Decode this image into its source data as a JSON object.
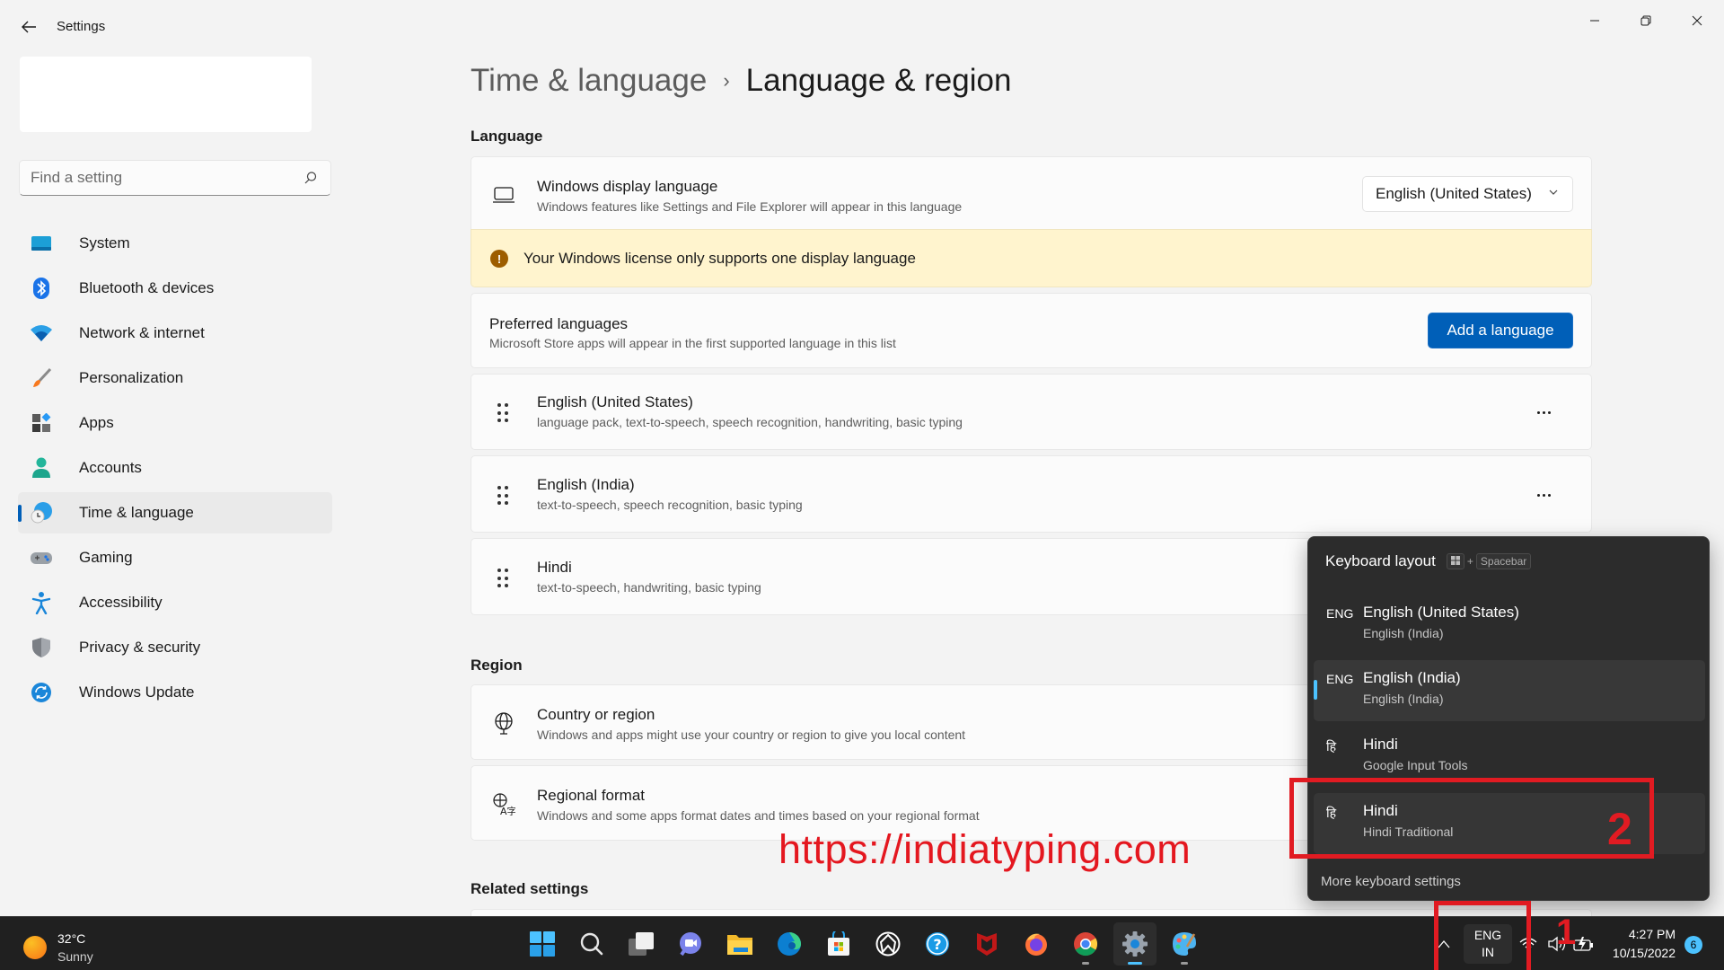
{
  "window": {
    "title": "Settings",
    "controls": {
      "minimize": "minimize",
      "restore": "restore",
      "close": "close"
    }
  },
  "search": {
    "placeholder": "Find a setting",
    "value": ""
  },
  "sidebar": {
    "items": [
      {
        "label": "System",
        "icon": "system-icon",
        "active": false
      },
      {
        "label": "Bluetooth & devices",
        "icon": "bluetooth-icon",
        "active": false
      },
      {
        "label": "Network & internet",
        "icon": "wifi-icon",
        "active": false
      },
      {
        "label": "Personalization",
        "icon": "brush-icon",
        "active": false
      },
      {
        "label": "Apps",
        "icon": "apps-icon",
        "active": false
      },
      {
        "label": "Accounts",
        "icon": "person-icon",
        "active": false
      },
      {
        "label": "Time & language",
        "icon": "globe-clock-icon",
        "active": true
      },
      {
        "label": "Gaming",
        "icon": "gamepad-icon",
        "active": false
      },
      {
        "label": "Accessibility",
        "icon": "accessibility-icon",
        "active": false
      },
      {
        "label": "Privacy & security",
        "icon": "shield-icon",
        "active": false
      },
      {
        "label": "Windows Update",
        "icon": "update-icon",
        "active": false
      }
    ]
  },
  "breadcrumb": {
    "parent": "Time & language",
    "separator": "›",
    "current": "Language & region"
  },
  "language": {
    "section_title": "Language",
    "display_language": {
      "title": "Windows display language",
      "desc": "Windows features like Settings and File Explorer will appear in this language",
      "selected": "English (United States)"
    },
    "warning": "Your Windows license only supports one display language",
    "preferred": {
      "title": "Preferred languages",
      "desc": "Microsoft Store apps will appear in the first supported language in this list",
      "button": "Add a language"
    },
    "list": [
      {
        "name": "English (United States)",
        "features": "language pack, text-to-speech, speech recognition, handwriting, basic typing"
      },
      {
        "name": "English (India)",
        "features": "text-to-speech, speech recognition, basic typing"
      },
      {
        "name": "Hindi",
        "features": "text-to-speech, handwriting, basic typing"
      }
    ]
  },
  "region": {
    "section_title": "Region",
    "country": {
      "title": "Country or region",
      "desc": "Windows and apps might use your country or region to give you local content"
    },
    "format": {
      "title": "Regional format",
      "desc": "Windows and some apps format dates and times based on your regional format"
    }
  },
  "related": {
    "section_title": "Related settings"
  },
  "watermark": "https://indiatyping.com",
  "keyboard_popup": {
    "title": "Keyboard layout",
    "shortcut_key": "Spacebar",
    "shortcut_plus": "+",
    "items": [
      {
        "code": "ENG",
        "name": "English (United States)",
        "sub": "English (India)",
        "selected": false
      },
      {
        "code": "ENG",
        "name": "English (India)",
        "sub": "English (India)",
        "selected": true
      },
      {
        "code": "हि",
        "name": "Hindi",
        "sub": "Google Input Tools",
        "selected": false
      },
      {
        "code": "हि",
        "name": "Hindi",
        "sub": "Hindi Traditional",
        "selected": false
      }
    ],
    "more": "More keyboard settings"
  },
  "annotations": {
    "one": "1",
    "two": "2"
  },
  "taskbar": {
    "weather": {
      "temp": "32°C",
      "condition": "Sunny"
    },
    "apps": [
      "start",
      "search",
      "task-view",
      "teams-chat",
      "file-explorer",
      "edge",
      "microsoft-store",
      "app-unknown",
      "help",
      "mcafee",
      "firefox",
      "chrome",
      "settings",
      "paint"
    ],
    "language": {
      "line1": "ENG",
      "line2": "IN"
    },
    "clock": {
      "time": "4:27 PM",
      "date": "10/15/2022"
    },
    "notifications": "6"
  },
  "colors": {
    "accent": "#005fb8",
    "warning_bg": "#fff4ce",
    "annotation": "#e11b22",
    "selection": "#4cc2ff"
  }
}
